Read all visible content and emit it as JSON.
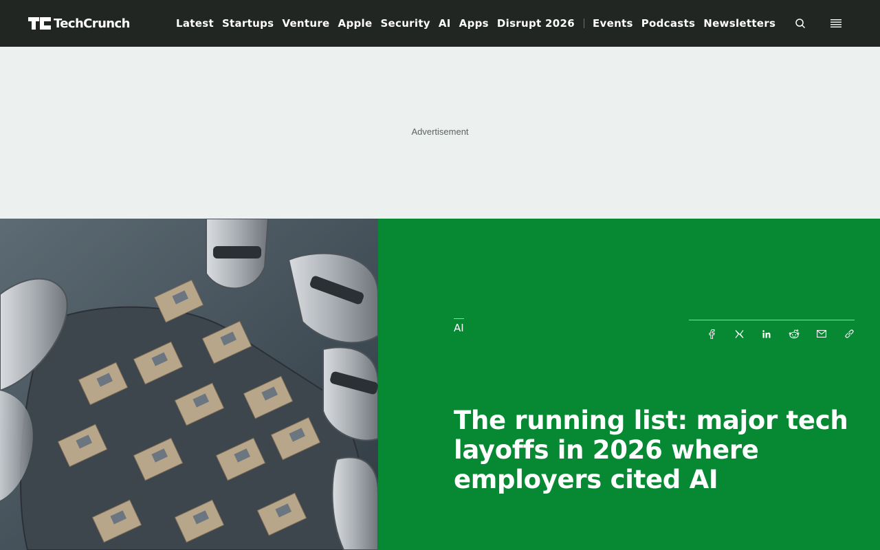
{
  "header": {
    "logo_text": "TechCrunch",
    "nav_primary": [
      "Latest",
      "Startups",
      "Venture",
      "Apple",
      "Security",
      "AI",
      "Apps",
      "Disrupt 2026"
    ],
    "nav_secondary": [
      "Events",
      "Podcasts",
      "Newsletters"
    ],
    "icons": [
      "search-icon",
      "menu-icon"
    ]
  },
  "ad": {
    "label": "Advertisement"
  },
  "article": {
    "category": "AI",
    "title": "The running list: major tech layoffs in 2026 where employers cited AI",
    "share_icons": [
      "facebook-icon",
      "x-icon",
      "linkedin-icon",
      "reddit-icon",
      "email-icon",
      "link-icon"
    ],
    "panel_color": "#078933"
  },
  "colors": {
    "topbar": "#222623",
    "ad_bg": "#ecf0ef",
    "accent_green": "#078933"
  }
}
